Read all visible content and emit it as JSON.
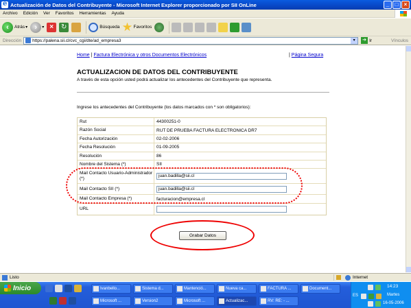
{
  "window": {
    "title": "Actualización de Datos del Contribuyente - Microsoft Internet Explorer proporcionado por SII OnLine",
    "minimize": "_",
    "maximize": "□",
    "close": "×"
  },
  "menu": [
    "Archivo",
    "Edición",
    "Ver",
    "Favoritos",
    "Herramientas",
    "Ayuda"
  ],
  "toolbar": {
    "back_label": "Atrás",
    "search_label": "Búsqueda",
    "favorites_label": "Favoritos"
  },
  "address": {
    "label": "Dirección",
    "url": "https://palena.sii.cl/cvc_cgi/dte/ad_empresa3",
    "go_label": "Ir",
    "links_label": "Vínculos"
  },
  "page": {
    "nav_home": "Home",
    "nav_sep": "|",
    "nav_factura": "Factura Electrónica y otros Documentos Electrónicos",
    "safe_sep": "|",
    "safe_page": "Página Segura",
    "title": "ACTUALIZACION DE DATOS DEL CONTRIBUYENTE",
    "subtitle": "A través de esta opción usted podrá actualizar los antecedentes del Contribuyente que representa.",
    "instructions": "Ingrese los antecedentes del Contribuyente (los datos marcados con * son obligatorios):",
    "rows": [
      {
        "label": "Rut",
        "value": "44300251-0"
      },
      {
        "label": "Razón Social",
        "value": "RUT DE PRUEBA FACTURA ELECTRONICA DR7"
      },
      {
        "label": "Fecha Autorización",
        "value": "02-02-2006"
      },
      {
        "label": "Fecha Resolución",
        "value": "01-09-2005"
      },
      {
        "label": "Resolución",
        "value": "86"
      },
      {
        "label": "Nombre del Sistema (*)",
        "value": "SII"
      },
      {
        "label": "Mail Contacto Usuario-Administrador (*)",
        "input": "juan.badilla@sii.cl"
      },
      {
        "label": "Mail Contacto SII (*)",
        "input": "juan.badilla@sii.cl"
      },
      {
        "label": "Mail Contacto Empresa (*)",
        "value": "facturacion@empresa.cl"
      },
      {
        "label": "URL",
        "input": ""
      }
    ],
    "save_button": "Grabar Datos"
  },
  "status": {
    "text": "Listo",
    "zone": "Internet"
  },
  "taskbar": {
    "start": "Inicio",
    "tasks_row1": [
      "Ivanbello...",
      "Sistema d...",
      "Mantenció...",
      "Nueva ca...",
      "FACTURA ...",
      "Document..."
    ],
    "tasks_row2": [
      "Microsoft ...",
      "Version2",
      "Microsoft ...",
      "Actualizac...",
      "RV: RE: - ..."
    ],
    "clock": "14:23",
    "day": "Martes",
    "date": "16-05-2006",
    "lang": "ES"
  }
}
